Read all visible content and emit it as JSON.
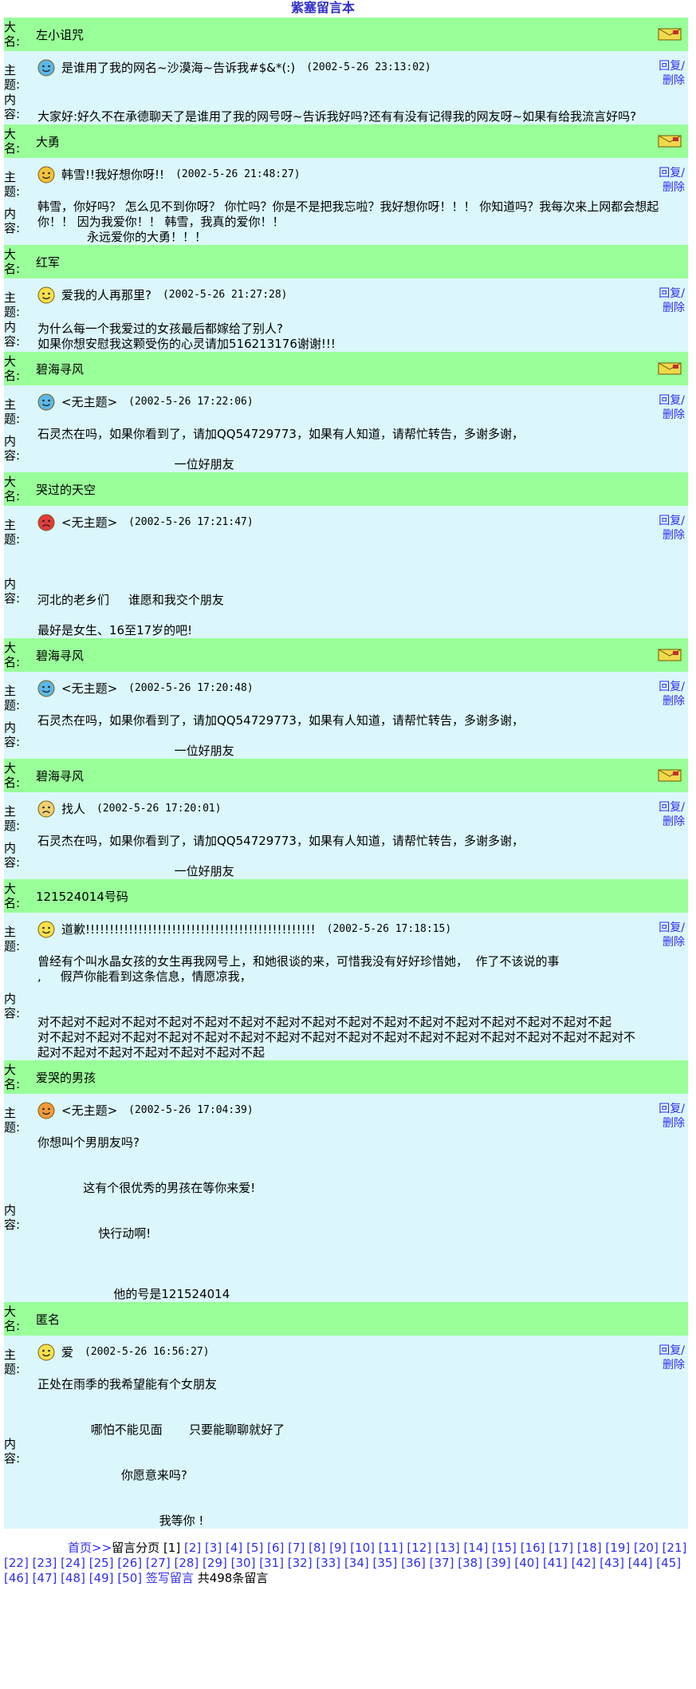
{
  "title": "紫塞留言本",
  "pager": {
    "home": "首页>>",
    "label": "留言分页",
    "pages": [
      "[1]",
      "[2]",
      "[3]",
      "[4]",
      "[5]",
      "[6]",
      "[7]",
      "[8]",
      "[9]",
      "[10]",
      "[11]",
      "[12]",
      "[13]",
      "[14]",
      "[15]",
      "[16]",
      "[17]",
      "[18]",
      "[19]",
      "[20]",
      "[21]",
      "[22]",
      "[23]",
      "[24]",
      "[25]",
      "[26]",
      "[27]",
      "[28]",
      "[29]",
      "[30]",
      "[31]",
      "[32]",
      "[33]",
      "[34]",
      "[35]",
      "[36]",
      "[37]",
      "[38]",
      "[39]",
      "[40]",
      "[41]",
      "[42]",
      "[43]",
      "[44]",
      "[45]",
      "[46]",
      "[47]",
      "[48]",
      "[49]",
      "[50]"
    ],
    "sign": "签写留言",
    "total": "共498条留言"
  },
  "labels": {
    "name": "大名:",
    "subject": "主题:",
    "content": "内容:",
    "reply": "回复/删除"
  },
  "colors": {
    "name_bar": "#99ff99",
    "body": "#dbf7fb",
    "link": "#2e2ef2"
  },
  "entries": [
    {
      "name": "左小诅咒",
      "mail": true,
      "face": "blue",
      "subject": "是谁用了我的网名~沙漠海~告诉我#$&*(:)",
      "time": "(2002-5-26 23:13:02)",
      "content": "大家好:好久不在承德聊天了是谁用了我的网号呀~告诉我好吗?还有有没有记得我的网友呀~如果有给我流言好吗?"
    },
    {
      "name": "大勇",
      "mail": true,
      "face": "laugh",
      "subject": "韩雪!!我好想你呀!!",
      "time": "(2002-5-26 21:48:27)",
      "content": "韩雪，你好吗？ 怎么见不到你呀？ 你忙吗？你是不是把我忘啦？我好想你呀！！！ 你知道吗？我每次来上网都会想起你！！ 因为我爱你！！ 韩雪，我真的爱你！！\n             永远爱你的大勇！！！"
    },
    {
      "name": "红军",
      "mail": false,
      "face": "yellow",
      "subject": "爱我的人再那里?",
      "time": "(2002-5-26 21:27:28)",
      "content": "为什么每一个我爱过的女孩最后都嫁给了别人?\n如果你想安慰我这颗受伤的心灵请加516213176谢谢!!!"
    },
    {
      "name": "碧海寻风",
      "mail": true,
      "face": "blue",
      "subject": "<无主题>",
      "time": "(2002-5-26 17:22:06)",
      "content": "石灵杰在吗，如果你看到了，请加QQ54729773，如果有人知道，请帮忙转告，多谢多谢，\n\n                                    一位好朋友"
    },
    {
      "name": "哭过的天空",
      "mail": false,
      "face": "red",
      "subject": "<无主题>",
      "time": "(2002-5-26 17:21:47)",
      "content": "\n\n\n河北的老乡们     谁愿和我交个朋友\n\n最好是女生、16至17岁的吧!"
    },
    {
      "name": "碧海寻风",
      "mail": true,
      "face": "blue",
      "subject": "<无主题>",
      "time": "(2002-5-26 17:20:48)",
      "content": "石灵杰在吗，如果你看到了，请加QQ54729773，如果有人知道，请帮忙转告，多谢多谢，\n\n                                    一位好朋友"
    },
    {
      "name": "碧海寻风",
      "mail": true,
      "face": "sad",
      "subject": "找人",
      "time": "(2002-5-26 17:20:01)",
      "content": "石灵杰在吗，如果你看到了，请加QQ54729773，如果有人知道，请帮忙转告，多谢多谢，\n\n                                    一位好朋友"
    },
    {
      "name": "121524014号码",
      "mail": false,
      "face": "yellow",
      "subject": "道歉!!!!!!!!!!!!!!!!!!!!!!!!!!!!!!!!!!!!!!!!!!!!!!!!",
      "time": "(2002-5-26 17:18:15)",
      "content": "曾经有个叫水晶女孩的女生再我网号上，和她很谈的来，可惜我没有好好珍惜她，  作了不该说的事\n,     假芦你能看到这条信息，情愿凉我，\n\n\n对不起对不起对不起对不起对不起对不起对不起对不起对不起对不起对不起对不起对不起对不起对不起对不起\n对不起对不起对不起对不起对不起对不起对不起对不起对不起对不起对不起对不起对不起对不起对不起对不起对不\n起对不起对不起对不起对不起对不起对不起"
    },
    {
      "name": "爱哭的男孩",
      "mail": false,
      "face": "orange",
      "subject": "<无主题>",
      "time": "(2002-5-26 17:04:39)",
      "content": "你想叫个男朋友吗?\n\n\n            这有个很优秀的男孩在等你来爱!\n\n\n                快行动啊!\n\n\n\n                    他的号是121524014"
    },
    {
      "name": "匿名",
      "mail": false,
      "face": "yellow",
      "subject": "爱",
      "time": "(2002-5-26 16:56:27)",
      "content": "正处在雨季的我希望能有个女朋友\n\n\n              哪怕不能见面       只要能聊聊就好了\n\n\n                      你愿意来吗?\n\n\n                                我等你 !"
    }
  ]
}
